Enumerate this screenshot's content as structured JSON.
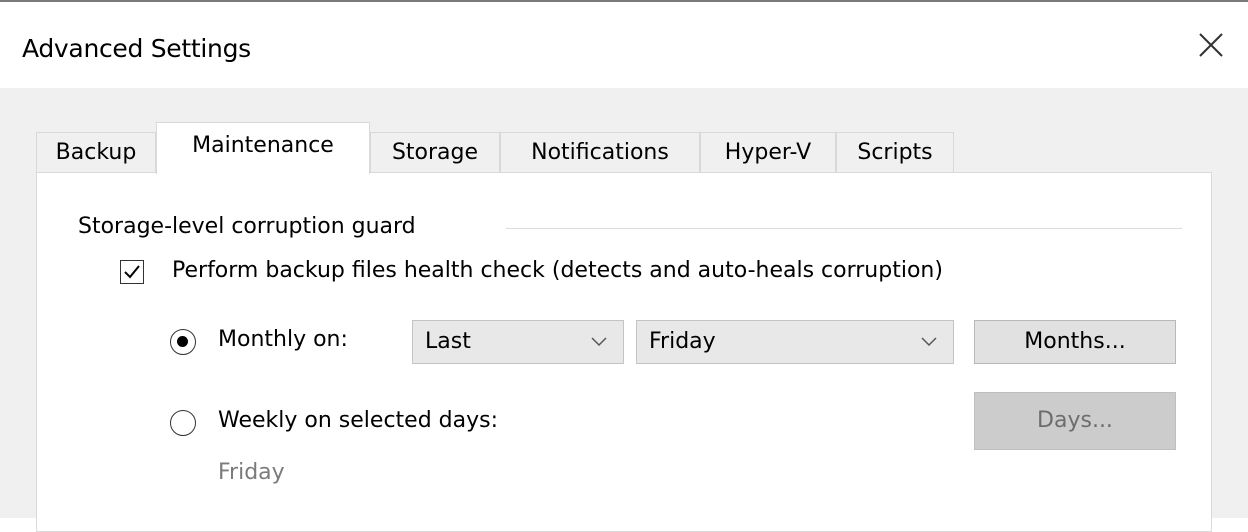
{
  "window": {
    "title": "Advanced Settings",
    "close_icon": "close-icon"
  },
  "tabs": [
    {
      "label": "Backup",
      "active": false
    },
    {
      "label": "Maintenance",
      "active": true
    },
    {
      "label": "Storage",
      "active": false
    },
    {
      "label": "Notifications",
      "active": false
    },
    {
      "label": "Hyper-V",
      "active": false
    },
    {
      "label": "Scripts",
      "active": false
    }
  ],
  "maintenance": {
    "group_label": "Storage-level corruption guard",
    "health_check": {
      "label": "Perform backup files health check (detects and auto-heals corruption)",
      "checked": true
    },
    "monthly": {
      "label": "Monthly on:",
      "selected": true,
      "week_select": "Last",
      "day_select": "Friday",
      "months_button": "Months..."
    },
    "weekly": {
      "label": "Weekly on selected days:",
      "selected": false,
      "days_button": "Days...",
      "days_button_enabled": false,
      "selected_days_text": "Friday"
    }
  }
}
